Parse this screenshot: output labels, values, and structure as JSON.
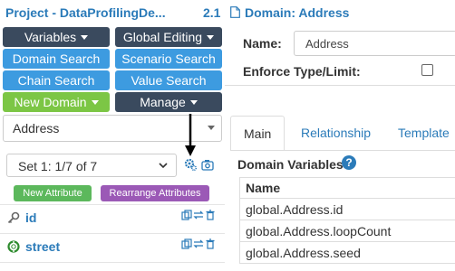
{
  "left": {
    "project_title": "Project - DataProfilingDe...",
    "version": "2.1",
    "buttons": {
      "variables": "Variables",
      "global_editing": "Global Editing",
      "domain_search": "Domain Search",
      "scenario_search": "Scenario Search",
      "chain_search": "Chain Search",
      "value_search": "Value Search",
      "new_domain": "New Domain",
      "manage": "Manage"
    },
    "domain_select_value": "Address",
    "set_select_value": "Set 1: 1/7 of 7",
    "new_attribute": "New Attribute",
    "rearrange_attributes": "Rearrange Attributes",
    "attributes": [
      {
        "name": "id",
        "icon": "key-icon"
      },
      {
        "name": "street",
        "icon": "lifebuoy-icon"
      }
    ]
  },
  "right": {
    "title": "Domain: Address",
    "name_label": "Name:",
    "name_value": "Address",
    "enforce_label": "Enforce Type/Limit:",
    "tabs": [
      "Main",
      "Relationship",
      "Template"
    ],
    "active_tab": "Main",
    "domain_variables_label": "Domain Variables",
    "table_header": "Name",
    "rows": [
      "global.Address.id",
      "global.Address.loopCount",
      "global.Address.seed"
    ]
  },
  "colors": {
    "link_blue": "#2b7bb9",
    "dark_button": "#3a4a5e",
    "blue_button": "#3d9be0",
    "green_button": "#7cc645",
    "tag_green": "#5cb85c",
    "tag_purple": "#9b59b6"
  }
}
